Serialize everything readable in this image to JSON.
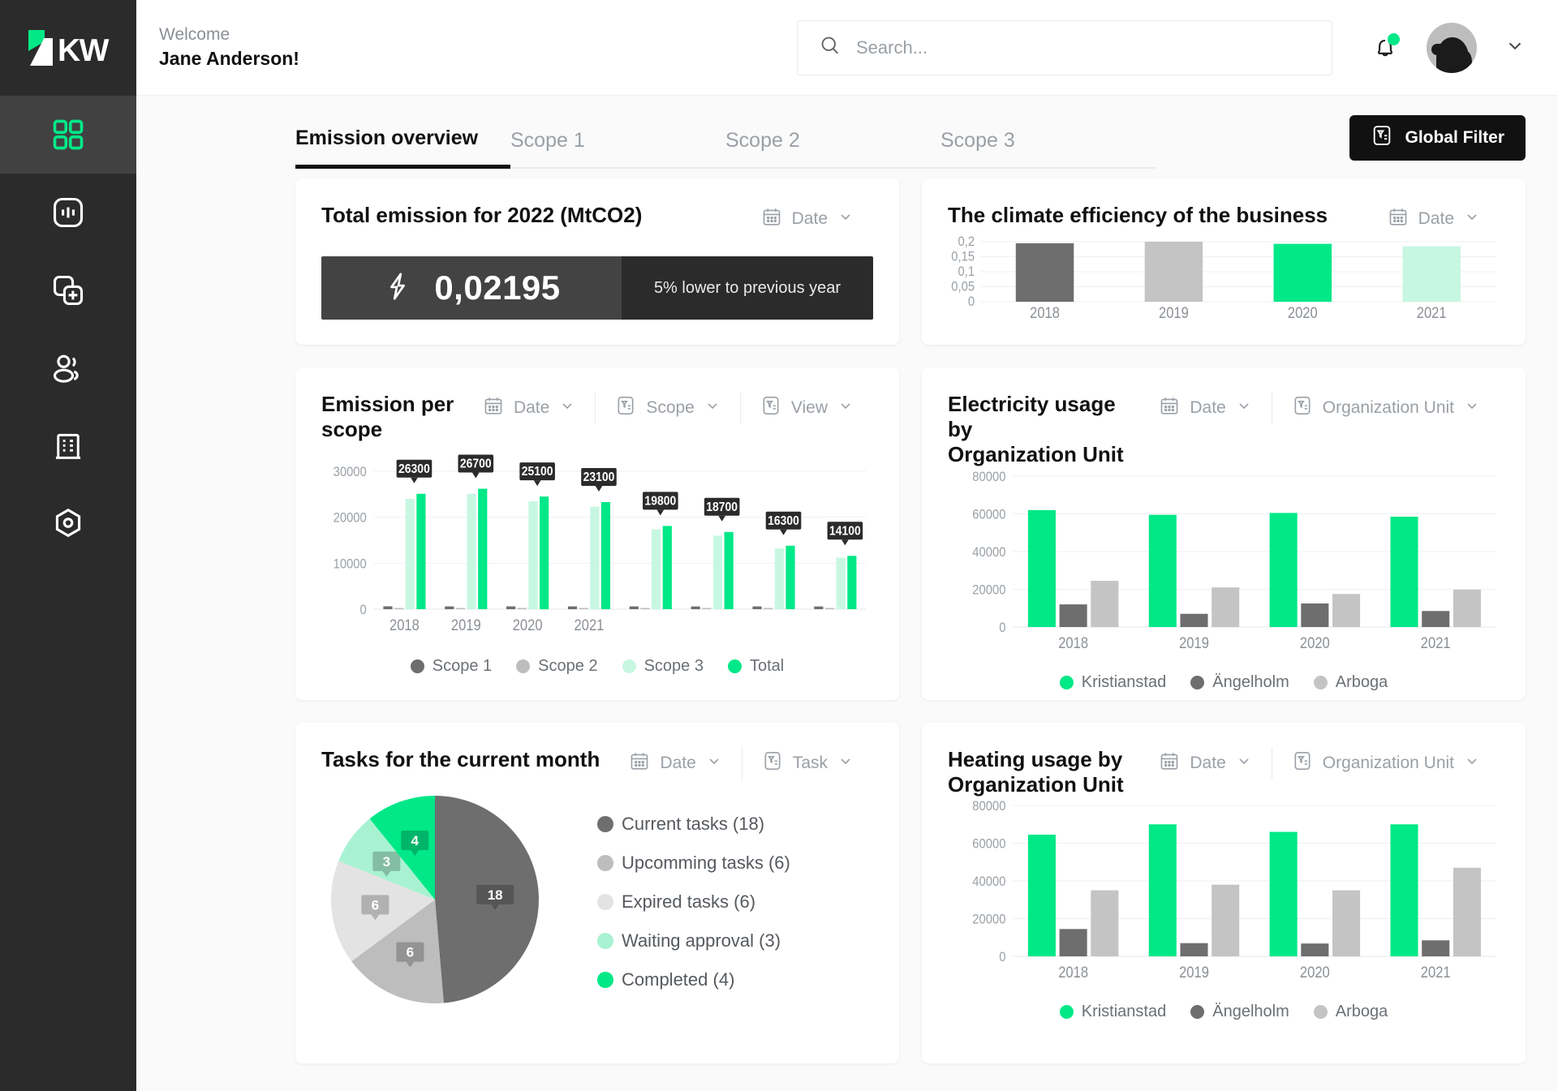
{
  "brand": {
    "logo_text": "KW",
    "green": "#00e887",
    "dark": "#2b2b2b"
  },
  "header": {
    "welcome_label": "Welcome",
    "user_name": "Jane Anderson!",
    "search_placeholder": "Search...",
    "search_value": ""
  },
  "sidebar": {
    "items": [
      {
        "name": "dashboard",
        "icon": "grid-icon",
        "active": true
      },
      {
        "name": "analytics",
        "icon": "chart-bars-icon",
        "active": false
      },
      {
        "name": "add-report",
        "icon": "copy-plus-icon",
        "active": false
      },
      {
        "name": "users",
        "icon": "users-icon",
        "active": false
      },
      {
        "name": "organizations",
        "icon": "building-icon",
        "active": false
      },
      {
        "name": "settings",
        "icon": "gear-hexagon-icon",
        "active": false
      }
    ]
  },
  "tabs": [
    {
      "label": "Emission overview",
      "active": true
    },
    {
      "label": "Scope 1",
      "active": false
    },
    {
      "label": "Scope 2",
      "active": false
    },
    {
      "label": "Scope 3",
      "active": false
    }
  ],
  "global_filter": {
    "label": "Global Filter",
    "icon": "filter-icon"
  },
  "cards": {
    "total_emission": {
      "title": "Total emission for 2022 (MtCO2)",
      "date_label": "Date",
      "value": "0,02195",
      "comparison": "5% lower to previous year",
      "icon": "lightning-icon"
    },
    "climate_efficiency": {
      "title": "The climate efficiency of the business",
      "date_label": "Date"
    },
    "emission_per_scope": {
      "title": "Emission per scope",
      "date_label": "Date",
      "scope_label": "Scope",
      "view_label": "View"
    },
    "electricity": {
      "title_line1": "Electricity usage by",
      "title_line2": "Organization Unit",
      "date_label": "Date",
      "org_label": "Organization Unit"
    },
    "tasks": {
      "title": "Tasks for the current month",
      "date_label": "Date",
      "task_label": "Task"
    },
    "heating": {
      "title_line1": "Heating usage by",
      "title_line2": "Organization Unit",
      "date_label": "Date",
      "org_label": "Organization Unit"
    }
  },
  "chart_data": [
    {
      "id": "climate_efficiency",
      "type": "bar",
      "title": "The climate efficiency of the business",
      "categories": [
        "2018",
        "2019",
        "2020",
        "2021"
      ],
      "values": [
        0.195,
        0.2,
        0.193,
        0.185
      ],
      "colors": [
        "#6e6e6e",
        "#c4c4c4",
        "#00e887",
        "#c7f7e2"
      ],
      "ylim": [
        0,
        0.2
      ],
      "ytick_labels": [
        "0,2",
        "0,15",
        "0,1",
        "0,05",
        "0"
      ],
      "ytick_values": [
        0.2,
        0.15,
        0.1,
        0.05,
        0
      ],
      "grid": true,
      "legend": "none"
    },
    {
      "id": "emission_per_scope",
      "type": "bar",
      "title": "Emission per scope",
      "categories": [
        "2018",
        "2019",
        "2020",
        "2021",
        "",
        "",
        "",
        ""
      ],
      "xtick_labels": [
        "2018",
        "2019",
        "2020",
        "2021"
      ],
      "series": [
        {
          "name": "Scope 1",
          "color": "#6e6e6e",
          "values": [
            620,
            600,
            610,
            600,
            600,
            590,
            600,
            590
          ]
        },
        {
          "name": "Scope 2",
          "color": "#bdbdbd",
          "values": [
            150,
            140,
            150,
            140,
            150,
            140,
            150,
            140
          ]
        },
        {
          "name": "Scope 3",
          "color": "#c7f7e2",
          "values": [
            24000,
            25100,
            23500,
            22300,
            17400,
            16000,
            13200,
            11200
          ]
        },
        {
          "name": "Total",
          "color": "#00e887",
          "values": [
            25100,
            26200,
            24500,
            23300,
            18100,
            16800,
            13800,
            11600
          ]
        }
      ],
      "bar_labels": [
        "26300",
        "26700",
        "25100",
        "23100",
        "19800",
        "18700",
        "16300",
        "14100"
      ],
      "ylim": [
        0,
        30000
      ],
      "ytick_labels": [
        "30000",
        "20000",
        "10000",
        "0"
      ],
      "ytick_values": [
        30000,
        20000,
        10000,
        0
      ],
      "grid": true,
      "legend": "bottom"
    },
    {
      "id": "electricity_usage",
      "type": "bar",
      "title": "Electricity usage by Organization Unit",
      "categories": [
        "2018",
        "2019",
        "2020",
        "2021"
      ],
      "series": [
        {
          "name": "Kristianstad",
          "color": "#00e887",
          "values": [
            62000,
            59500,
            60500,
            58500
          ]
        },
        {
          "name": "Ängelholm",
          "color": "#6e6e6e",
          "values": [
            12000,
            7000,
            12500,
            8500
          ]
        },
        {
          "name": "Arboga",
          "color": "#c4c4c4",
          "values": [
            24500,
            21000,
            17500,
            19800
          ]
        }
      ],
      "ylim": [
        0,
        80000
      ],
      "ytick_labels": [
        "80000",
        "60000",
        "40000",
        "20000",
        "0"
      ],
      "ytick_values": [
        80000,
        60000,
        40000,
        20000,
        0
      ],
      "grid": true,
      "legend": "bottom"
    },
    {
      "id": "tasks_pie",
      "type": "pie",
      "title": "Tasks for the current month",
      "slices": [
        {
          "label": "Current tasks",
          "value": 18,
          "color": "#6e6e6e"
        },
        {
          "label": "Upcomming tasks",
          "value": 6,
          "color": "#bdbdbd"
        },
        {
          "label": "Expired tasks",
          "value": 6,
          "color": "#e3e3e3"
        },
        {
          "label": "Waiting approval",
          "value": 3,
          "color": "#a8f2d2"
        },
        {
          "label": "Completed",
          "value": 4,
          "color": "#00e887"
        }
      ],
      "legend_labels": [
        "Current tasks (18)",
        "Upcomming tasks (6)",
        "Expired tasks (6)",
        "Waiting approval (3)",
        "Completed (4)"
      ],
      "total": 37,
      "legend": "right"
    },
    {
      "id": "heating_usage",
      "type": "bar",
      "title": "Heating usage by Organization Unit",
      "categories": [
        "2018",
        "2019",
        "2020",
        "2021"
      ],
      "series": [
        {
          "name": "Kristianstad",
          "color": "#00e887",
          "values": [
            64500,
            70000,
            66000,
            70000
          ]
        },
        {
          "name": "Ängelholm",
          "color": "#6e6e6e",
          "values": [
            14500,
            7000,
            6800,
            8500
          ]
        },
        {
          "name": "Arboga",
          "color": "#c4c4c4",
          "values": [
            35000,
            38000,
            35000,
            47000
          ]
        }
      ],
      "ylim": [
        0,
        80000
      ],
      "ytick_labels": [
        "80000",
        "60000",
        "40000",
        "20000",
        "0"
      ],
      "ytick_values": [
        80000,
        60000,
        40000,
        20000,
        0
      ],
      "grid": true,
      "legend": "bottom"
    }
  ]
}
